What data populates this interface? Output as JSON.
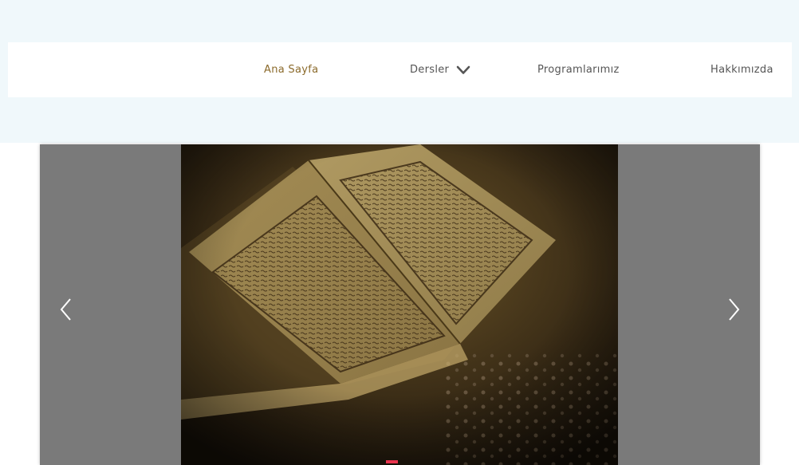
{
  "nav": {
    "items": [
      {
        "label": "Ana Sayfa",
        "active": true
      },
      {
        "label": "Dersler",
        "has_dropdown": true
      },
      {
        "label": "Programlarımız"
      },
      {
        "label": "Hakkımızda"
      }
    ],
    "active_color": "#8b6a2b",
    "text_color": "#555555",
    "dropdown_icon": "chevron-down-icon"
  },
  "slider": {
    "image": "open-quran-book",
    "prev_icon": "chevron-left-icon",
    "next_icon": "chevron-right-icon",
    "slide_count": 1,
    "active_slide": 1,
    "indicator_color": "#e8344e"
  },
  "colors": {
    "header_background": "#f0f8fb",
    "slider_background": "#7a7a7a"
  }
}
